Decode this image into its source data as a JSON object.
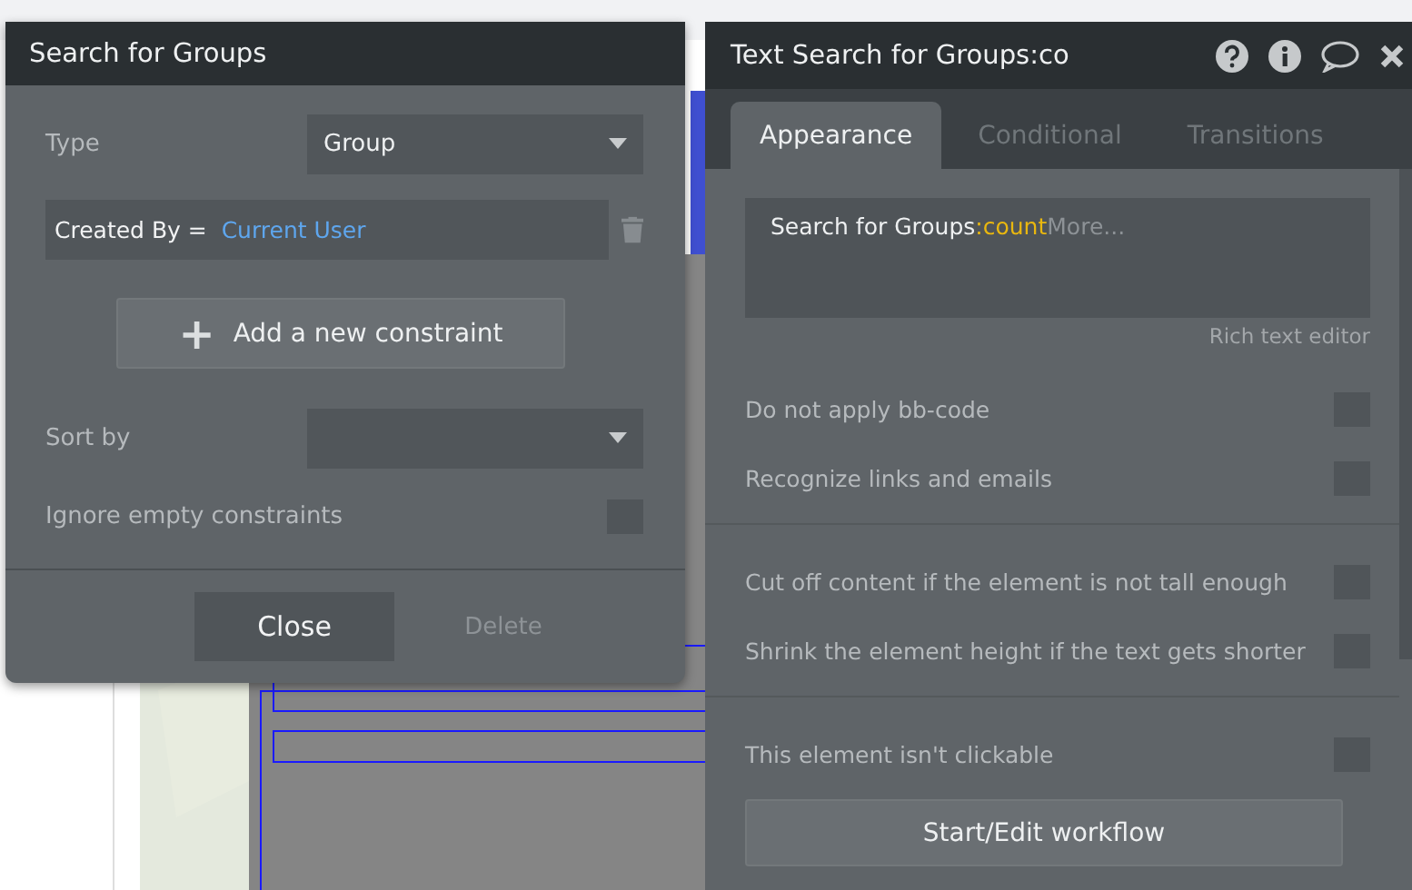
{
  "search_dialog": {
    "title": "Search for Groups",
    "type_label": "Type",
    "type_value": "Group",
    "constraint": {
      "field": "Created By =",
      "value": "Current User"
    },
    "add_button": "Add a new constraint",
    "add_icon": "+",
    "sort_label": "Sort by",
    "ignore": {
      "label": "Ignore empty constraints",
      "checked": false
    },
    "buttons": [
      {
        "label": "Close",
        "disabled": false
      },
      {
        "label": "Delete",
        "disabled": true
      }
    ]
  },
  "inspector": {
    "title": "Text Search for Groups:co",
    "tabs": [
      {
        "label": "Appearance",
        "selected": true
      },
      {
        "label": "Conditional",
        "selected": false
      },
      {
        "label": "Transitions",
        "selected": false
      }
    ],
    "content": [
      {
        "kind": "text",
        "text": "Search for Groups"
      },
      {
        "kind": "operator",
        "text": ":count"
      },
      {
        "kind": "more",
        "text": "More..."
      }
    ],
    "rich_text_link": "Rich text editor",
    "groups": [
      [
        {
          "label": "Do not apply bb-code",
          "checked": false
        },
        {
          "label": "Recognize links and emails",
          "checked": false
        }
      ],
      [
        {
          "label": "Cut off content if the element is not tall enough",
          "checked": false
        },
        {
          "label": "Shrink the element height if the text gets shorter",
          "checked": false
        }
      ],
      [
        {
          "label": "This element isn't clickable",
          "checked": false
        }
      ]
    ],
    "workflow_button": "Start/Edit workflow"
  }
}
